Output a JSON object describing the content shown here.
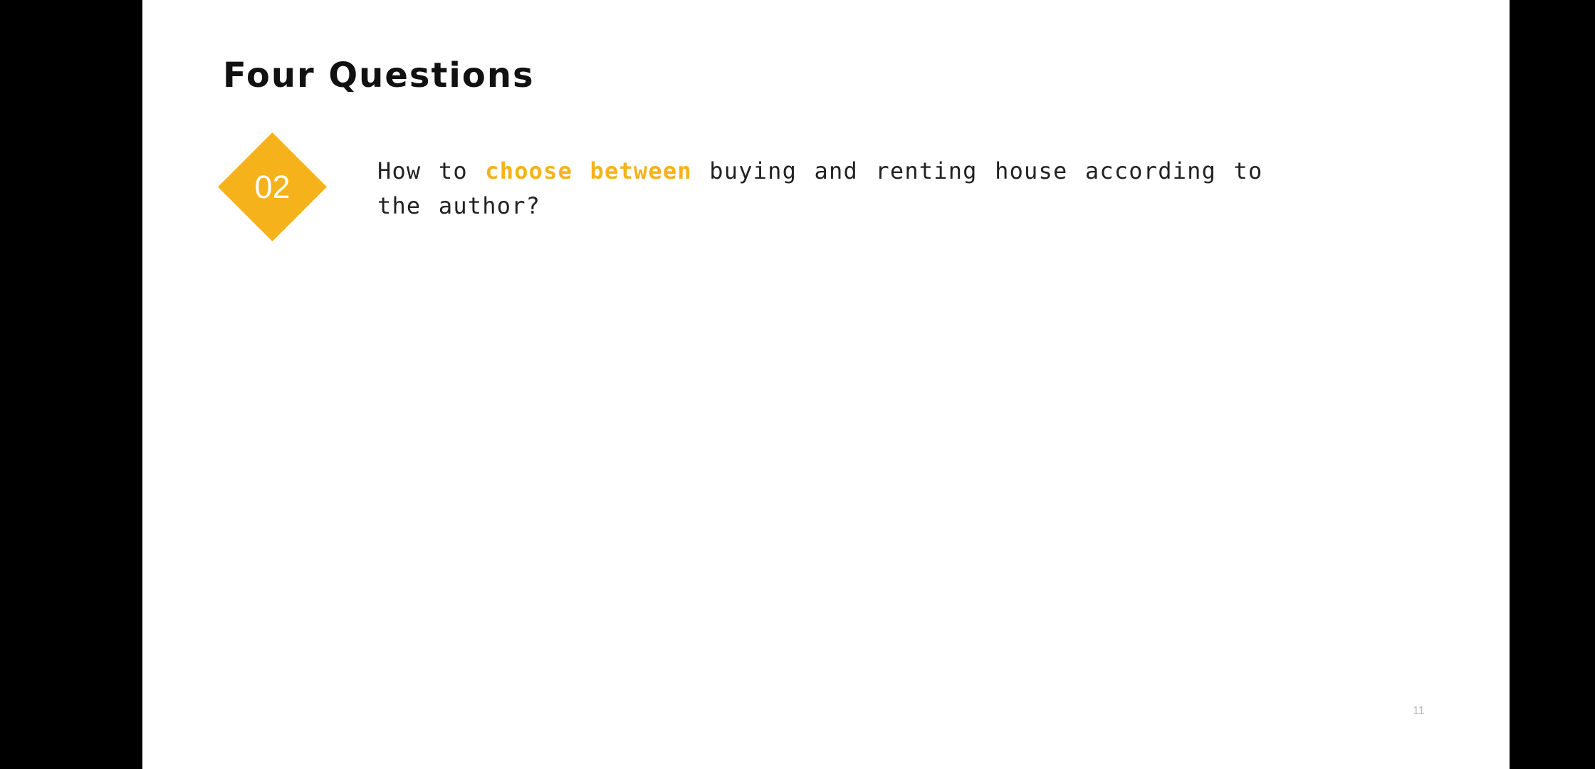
{
  "slide": {
    "title": "Four Questions",
    "badge": {
      "number": "02",
      "color": "#f5b21a"
    },
    "question": {
      "before": "How to ",
      "highlight": "choose between",
      "after": " buying and renting house according to the author?",
      "highlight_color": "#f5b21a"
    },
    "page_number": "11"
  }
}
